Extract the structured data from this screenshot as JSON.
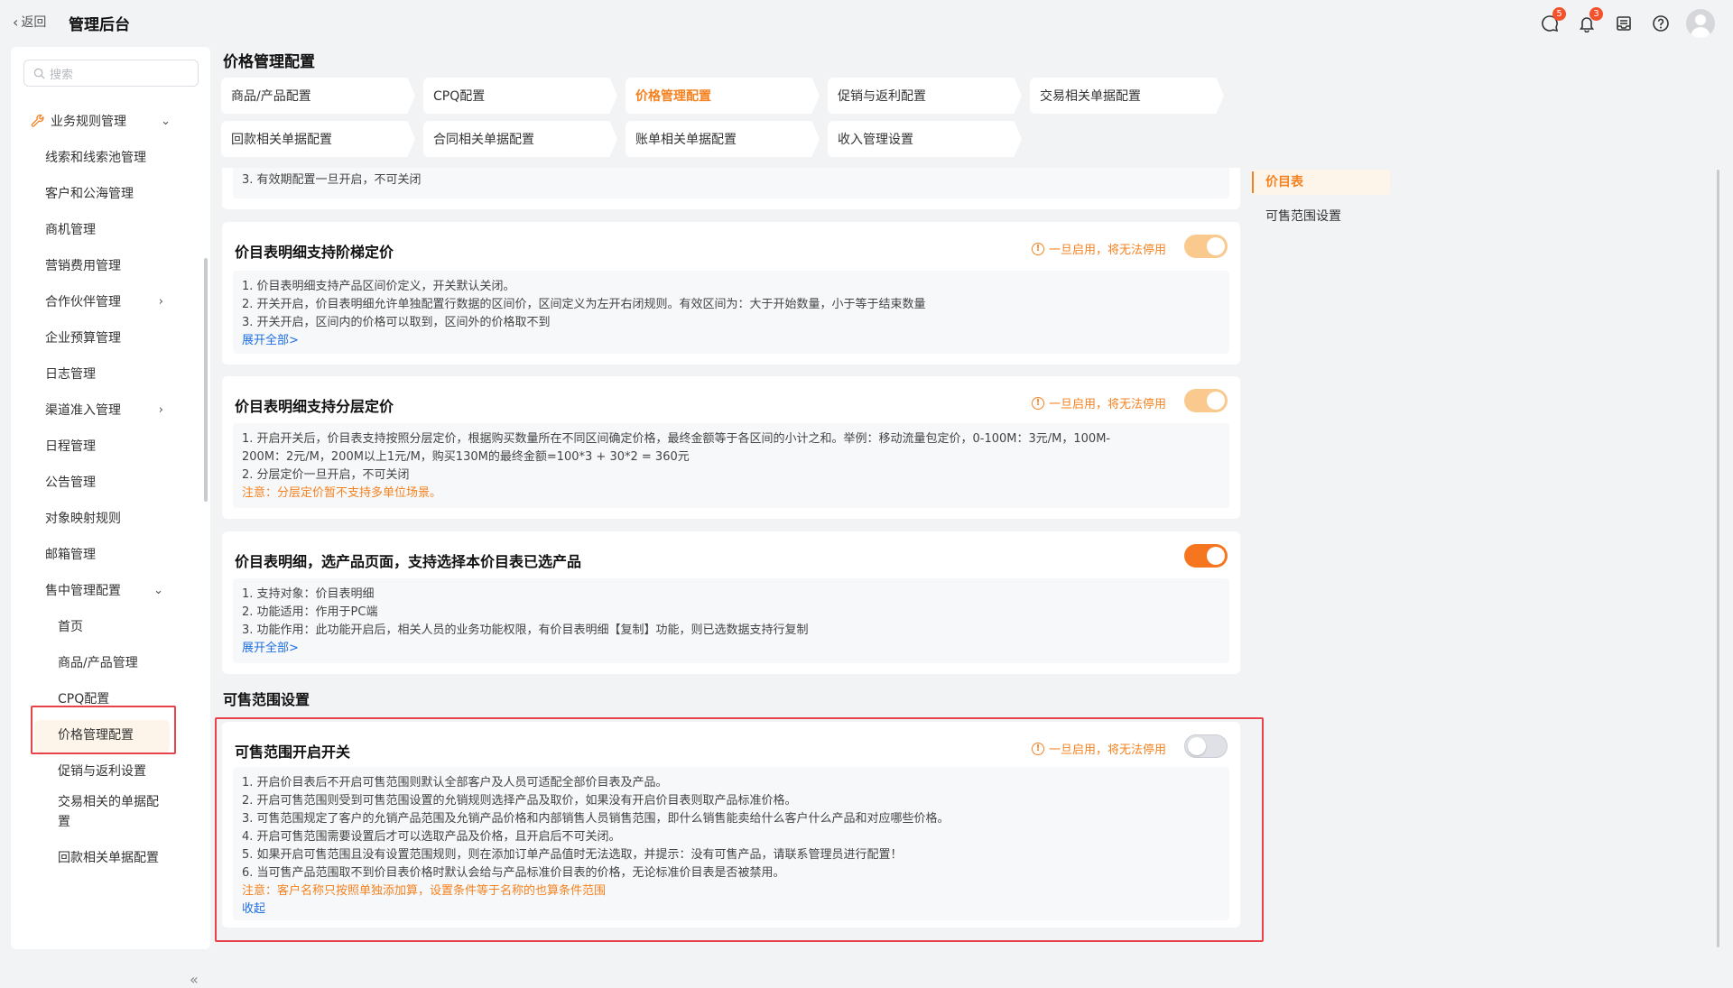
{
  "topbar": {
    "back_label": "返回",
    "app_title": "管理后台",
    "chat_badge": "5",
    "bell_badge": "3"
  },
  "sidebar": {
    "search_placeholder": "搜索",
    "group_label": "业务规则管理",
    "items": [
      {
        "label": "线索和线索池管理"
      },
      {
        "label": "客户和公海管理"
      },
      {
        "label": "商机管理"
      },
      {
        "label": "营销费用管理"
      },
      {
        "label": "合作伙伴管理"
      },
      {
        "label": "企业预算管理"
      },
      {
        "label": "日志管理"
      },
      {
        "label": "渠道准入管理"
      },
      {
        "label": "日程管理"
      },
      {
        "label": "公告管理"
      },
      {
        "label": "对象映射规则"
      },
      {
        "label": "邮箱管理"
      },
      {
        "label": "售中管理配置"
      }
    ],
    "sub_items": [
      {
        "label": "首页"
      },
      {
        "label": "商品/产品管理"
      },
      {
        "label": "CPQ配置"
      },
      {
        "label": "价格管理配置"
      },
      {
        "label": "促销与返利设置"
      },
      {
        "label": "交易相关的单据配置"
      },
      {
        "label": "回款相关单据配置"
      }
    ]
  },
  "main": {
    "heading": "价格管理配置",
    "tabs": [
      {
        "label": "商品/产品配置"
      },
      {
        "label": "CPQ配置"
      },
      {
        "label": "价格管理配置"
      },
      {
        "label": "促销与返利配置"
      },
      {
        "label": "交易相关单据配置"
      },
      {
        "label": "回款相关单据配置"
      },
      {
        "label": "合同相关单据配置"
      },
      {
        "label": "账单相关单据配置"
      },
      {
        "label": "收入管理设置"
      }
    ],
    "top_fragment": "3. 有效期配置一旦开启，不可关闭",
    "cards": [
      {
        "title": "价目表明细支持阶梯定价",
        "warning": "一旦启用，将无法停用",
        "lines": [
          "1. 价目表明细支持产品区间价定义，开关默认关闭。",
          "2. 开关开启，价目表明细允许单独配置行数据的区间价，区间定义为左开右闭规则。有效区间为：大于开始数量，小于等于结束数量",
          "3. 开关开启，区间内的价格可以取到，区间外的价格取不到"
        ],
        "link": "展开全部>"
      },
      {
        "title": "价目表明细支持分层定价",
        "warning": "一旦启用，将无法停用",
        "lines": [
          "1. 开启开关后，价目表支持按照分层定价，根据购买数量所在不同区间确定价格，最终金额等于各区间的小计之和。举例：移动流量包定价，0-100M：3元/M，100M-",
          "200M：2元/M，200M以上1元/M，购买130M的最终金额=100*3 + 30*2 = 360元",
          "2. 分层定价一旦开启，不可关闭"
        ],
        "note": "注意：分层定价暂不支持多单位场景。"
      },
      {
        "title": "价目表明细，选产品页面，支持选择本价目表已选产品",
        "lines": [
          "1. 支持对象：价目表明细",
          "2. 功能适用：作用于PC端",
          "3. 功能作用：此功能开启后，相关人员的业务功能权限，有价目表明细【复制】功能，则已选数据支持行复制"
        ],
        "link": "展开全部>"
      }
    ],
    "section_label": "可售范围设置",
    "scope_card": {
      "title": "可售范围开启开关",
      "warning": "一旦启用，将无法停用",
      "lines": [
        "1. 开启价目表后不开启可售范围则默认全部客户及人员可适配全部价目表及产品。",
        "2. 开启可售范围则受到可售范围设置的允销规则选择产品及取价，如果没有开启价目表则取产品标准价格。",
        "3. 可售范围规定了客户的允销产品范围及允销产品价格和内部销售人员销售范围，即什么销售能卖给什么客户什么产品和对应哪些价格。",
        "4. 开启可售范围需要设置后才可以选取产品及价格，且开启后不可关闭。",
        "5. 如果开启可售范围且没有设置范围规则，则在添加订单产品值时无法选取，并提示：没有可售产品，请联系管理员进行配置！",
        "6. 当可售产品范围取不到价目表价格时默认会给与产品标准价目表的价格，无论标准价目表是否被禁用。"
      ],
      "note": "注意：客户名称只按照单独添加算，设置条件等于名称的也算条件范围",
      "link": "收起"
    }
  },
  "anchor": {
    "items": [
      {
        "label": "价目表"
      },
      {
        "label": "可售范围设置"
      }
    ]
  }
}
